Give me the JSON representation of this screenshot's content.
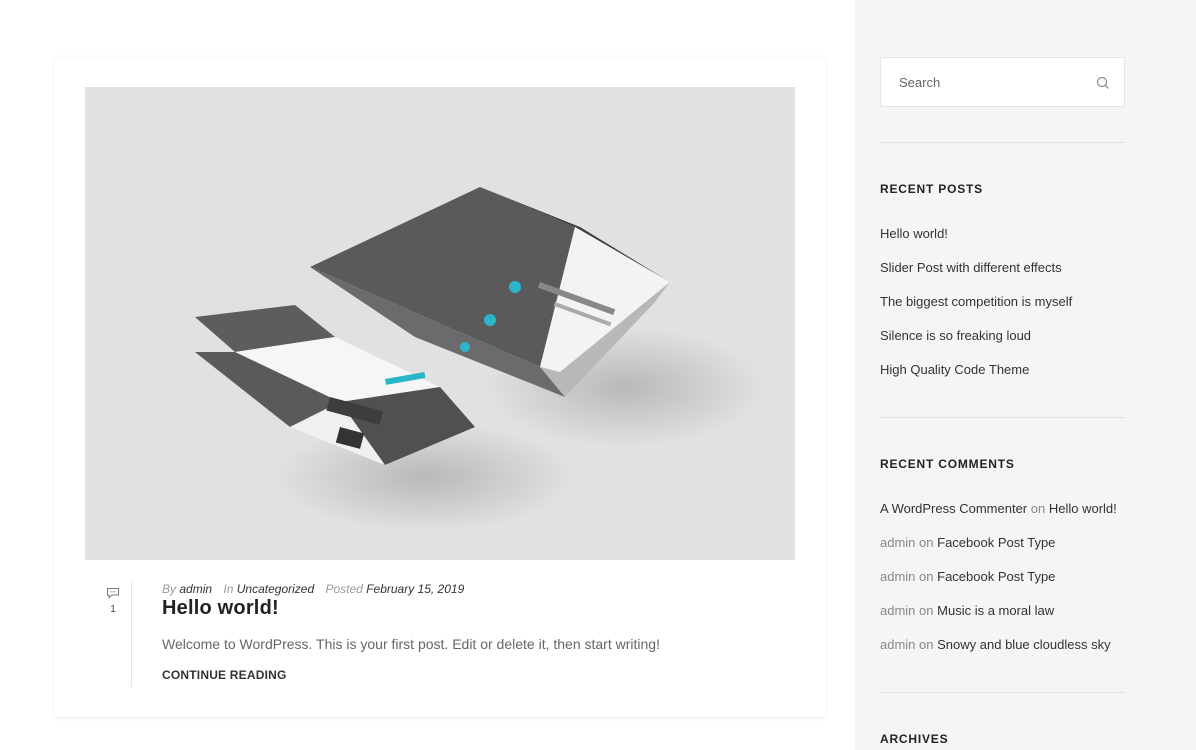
{
  "post": {
    "comment_count": "1",
    "meta": {
      "by_label": "By",
      "author": "admin",
      "in_label": "In",
      "category": "Uncategorized",
      "posted_label": "Posted",
      "date": "February 15, 2019"
    },
    "title": "Hello world!",
    "excerpt": "Welcome to WordPress. This is your first post. Edit or delete it, then start writing!",
    "continue_label": "CONTINUE READING"
  },
  "sidebar": {
    "search": {
      "placeholder": "Search"
    },
    "recent_posts": {
      "title": "RECENT POSTS",
      "items": [
        "Hello world!",
        "Slider Post with different effects",
        "The biggest competition is myself",
        "Silence is so freaking loud",
        "High Quality Code Theme"
      ]
    },
    "recent_comments": {
      "title": "RECENT COMMENTS",
      "items": [
        {
          "author": "A WordPress Commenter",
          "on": "on",
          "post": "Hello world!"
        },
        {
          "author": "admin",
          "on": "on",
          "post": "Facebook Post Type"
        },
        {
          "author": "admin",
          "on": "on",
          "post": "Facebook Post Type"
        },
        {
          "author": "admin",
          "on": "on",
          "post": "Music is a moral law"
        },
        {
          "author": "admin",
          "on": "on",
          "post": "Snowy and blue cloudless sky"
        }
      ]
    },
    "archives": {
      "title": "ARCHIVES"
    }
  },
  "icons": {
    "comment": "speech-bubble-icon",
    "search": "search-icon"
  },
  "colors": {
    "sidebar_bg": "#f5f5f5",
    "image_bg": "#e2e1e2",
    "accent": "#29b6c9"
  }
}
